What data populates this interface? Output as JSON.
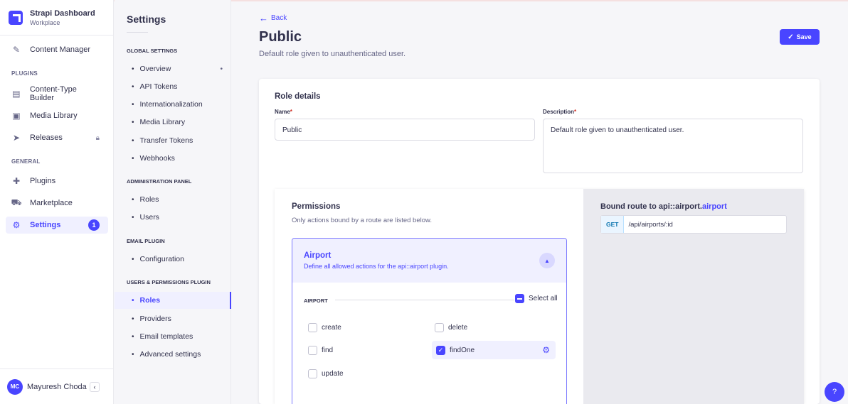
{
  "app": {
    "title": "Strapi Dashboard",
    "workspace": "Workplace"
  },
  "mainnav": {
    "content_manager": "Content Manager",
    "plugins_section": "PLUGINS",
    "ctb": "Content-Type Builder",
    "media": "Media Library",
    "releases": "Releases",
    "general_section": "GENERAL",
    "plugins": "Plugins",
    "marketplace": "Marketplace",
    "settings": "Settings",
    "settings_badge": "1"
  },
  "user": {
    "initials": "MC",
    "name": "Mayuresh Choda...",
    "collapse": "‹"
  },
  "subnav": {
    "title": "Settings",
    "global_section": "GLOBAL SETTINGS",
    "overview": "Overview",
    "overview_dot": "•",
    "api_tokens": "API Tokens",
    "i18n": "Internationalization",
    "media_library": "Media Library",
    "transfer_tokens": "Transfer Tokens",
    "webhooks": "Webhooks",
    "admin_section": "ADMINISTRATION PANEL",
    "roles": "Roles",
    "users": "Users",
    "email_section": "EMAIL PLUGIN",
    "configuration": "Configuration",
    "up_section": "USERS & PERMISSIONS PLUGIN",
    "up_roles": "Roles",
    "providers": "Providers",
    "email_templates": "Email templates",
    "advanced": "Advanced settings"
  },
  "header": {
    "back": "Back",
    "title": "Public",
    "subtitle": "Default role given to unauthenticated user.",
    "save": "Save"
  },
  "role_details": {
    "title": "Role details",
    "name_label": "Name",
    "name_value": "Public",
    "desc_label": "Description",
    "desc_value": "Default role given to unauthenticated user.",
    "required_mark": "*"
  },
  "permissions": {
    "title": "Permissions",
    "subtitle": "Only actions bound by a route are listed below.",
    "plugin_name": "Airport",
    "plugin_desc": "Define all allowed actions for the api::airport plugin.",
    "group": "AIRPORT",
    "select_all": "Select all",
    "actions": [
      {
        "label": "create",
        "checked": false
      },
      {
        "label": "delete",
        "checked": false
      },
      {
        "label": "find",
        "checked": false
      },
      {
        "label": "findOne",
        "checked": true
      },
      {
        "label": "update",
        "checked": false
      }
    ]
  },
  "bound_route": {
    "title_prefix": "Bound route to api::airport.",
    "title_highlight": "airport",
    "method": "GET",
    "path": "/api/airports/:id"
  },
  "help": "?",
  "colors": {
    "primary": "#4945ff",
    "primary_light": "#f0f0ff",
    "text": "#32324d",
    "muted": "#666687"
  }
}
